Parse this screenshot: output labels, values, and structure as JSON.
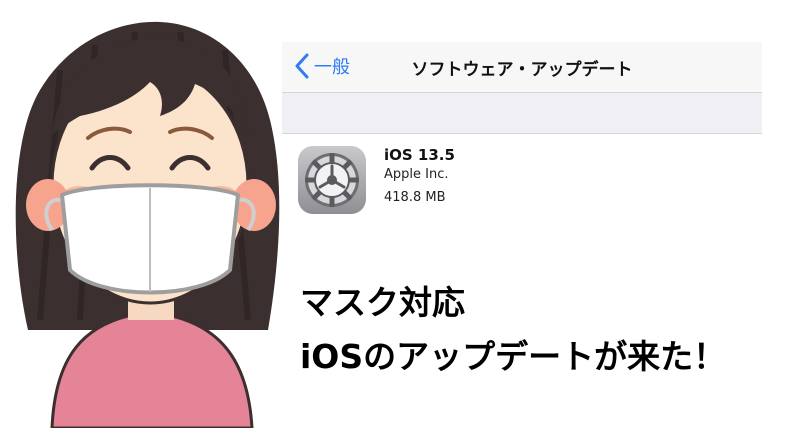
{
  "ios_screen": {
    "nav": {
      "back_label": "一般",
      "title": "ソフトウェア・アップデート"
    },
    "update": {
      "name": "iOS 13.5",
      "vendor": "Apple Inc.",
      "size": "418.8 MB",
      "icon": "settings-gear-icon"
    }
  },
  "caption": {
    "line1": "マスク対応",
    "line2": "iOSのアップデートが来た！"
  },
  "colors": {
    "ios_blue": "#2f7cf6",
    "nav_background": "#f7f7f8",
    "group_background": "#efeff4",
    "shirt_pink": "#e58397",
    "hair": "#3b2f2f",
    "mask": "#ffffff"
  }
}
